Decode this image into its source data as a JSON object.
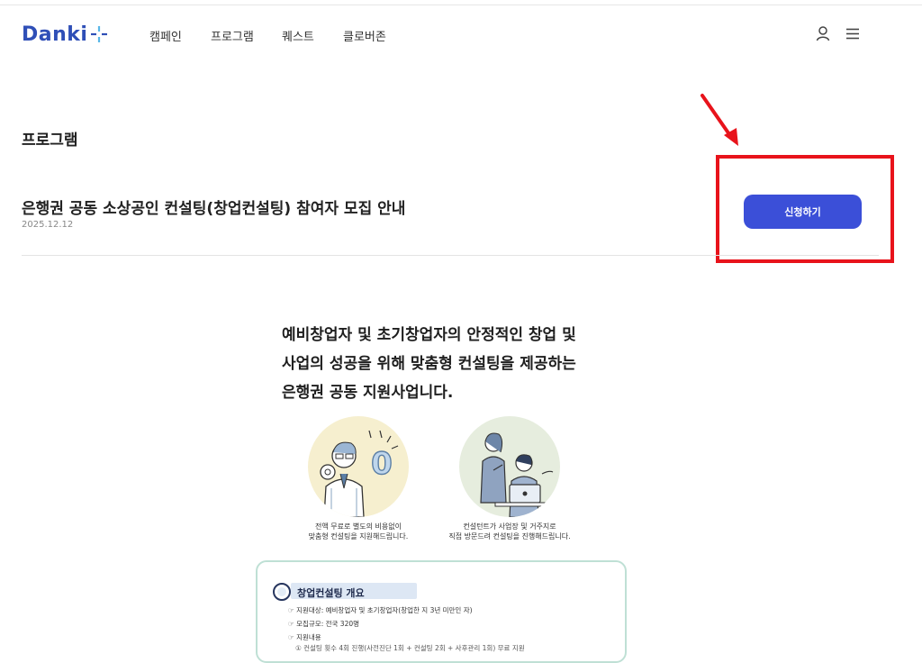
{
  "header": {
    "logo_text": "Danki",
    "nav": [
      "캠페인",
      "프로그램",
      "퀘스트",
      "클로버존"
    ],
    "user_icon": "user-icon",
    "menu_icon": "hamburger-menu-icon"
  },
  "page": {
    "heading": "프로그램"
  },
  "post": {
    "title": "은행권 공동 소상공인 컨설팅(창업컨설팅) 참여자 모집 안내",
    "date": "2025.12.12",
    "apply_label": "신청하기"
  },
  "colors": {
    "brand": "#2f4fb7",
    "button": "#3b4fd8",
    "highlight": "#e8131b"
  },
  "poster": {
    "intro_lines": [
      "예비창업자 및 초기창업자의 안정적인 창업 및",
      "사업의 성공을 위해 맞춤형 컨설팅을 제공하는",
      "은행권 공동 지원사업니다."
    ],
    "badge_value": "0",
    "caption1": [
      "전액 무료로 별도의 비용없이",
      "맞춤형 컨설팅을 지원해드립니다."
    ],
    "caption2": [
      "컨설턴트가 사업장 및 거주지로",
      "직접 방문드려 컨설팅을 진행해드립니다."
    ],
    "card_title": "창업컨설팅 개요",
    "card_lines": [
      "☞ 지원대상: 예비창업자 및 초기창업자(창업한 지 3년 미만인 자)",
      "☞ 모집규모: 전국 320명",
      "☞ 지원내용",
      "① 컨설팅 횟수 4회 진행(사전진단 1회 + 컨설팅 2회 + 사후관리 1회) 무료 지원"
    ]
  }
}
